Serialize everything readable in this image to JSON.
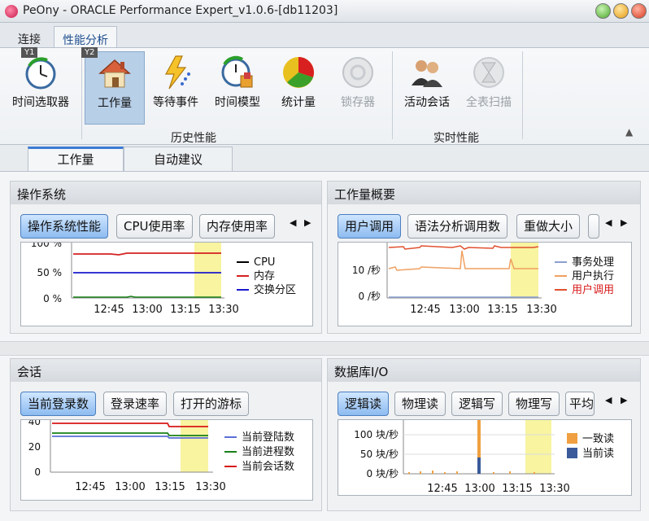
{
  "window": {
    "title": "PeOny - ORACLE Performance Expert_v1.0.6-[db11203]"
  },
  "menu_tabs": [
    {
      "label": "连接"
    },
    {
      "label": "性能分析"
    }
  ],
  "ribbon": {
    "badges": {
      "y1": "Y1",
      "y2": "Y2"
    },
    "buttons": [
      {
        "label": "时间选取器",
        "icon": "clock-icon"
      },
      {
        "label": "工作量",
        "icon": "house-icon"
      },
      {
        "label": "等待事件",
        "icon": "lightning-icon"
      },
      {
        "label": "时间模型",
        "icon": "model-clock-icon"
      },
      {
        "label": "统计量",
        "icon": "pie-chart-icon"
      },
      {
        "label": "锁存器",
        "icon": "latch-icon"
      },
      {
        "label": "活动会话",
        "icon": "users-icon"
      },
      {
        "label": "全表扫描",
        "icon": "hourglass-icon"
      }
    ],
    "groups": {
      "history": "历史性能",
      "realtime": "实时性能"
    }
  },
  "doc_tabs": [
    {
      "label": "工作量"
    },
    {
      "label": "自动建议"
    }
  ],
  "panels": {
    "os": {
      "title": "操作系统",
      "tabs": [
        "操作系统性能",
        "CPU使用率",
        "内存使用率"
      ],
      "y_ticks": [
        "100 %",
        "50 %",
        "0 %"
      ],
      "x_ticks": [
        "12:45",
        "13:00",
        "13:15",
        "13:30"
      ],
      "legend": [
        "CPU",
        "内存",
        "交换分区"
      ]
    },
    "workload": {
      "title": "工作量概要",
      "tabs": [
        "用户调用",
        "语法分析调用数",
        "重做大小"
      ],
      "y_ticks": [
        "10 /秒",
        "0 /秒"
      ],
      "x_ticks": [
        "12:45",
        "13:00",
        "13:15",
        "13:30"
      ],
      "legend": [
        "事务处理",
        "用户执行",
        "用户调用"
      ]
    },
    "session": {
      "title": "会话",
      "tabs": [
        "当前登录数",
        "登录速率",
        "打开的游标"
      ],
      "y_ticks": [
        "40",
        "20",
        "0"
      ],
      "x_ticks": [
        "12:45",
        "13:00",
        "13:15",
        "13:30"
      ],
      "legend": [
        "当前登陆数",
        "当前进程数",
        "当前会话数"
      ]
    },
    "dbio": {
      "title": "数据库I/O",
      "tabs": [
        "逻辑读",
        "物理读",
        "逻辑写",
        "物理写",
        "平均"
      ],
      "y_ticks": [
        "100 块/秒",
        "50 块/秒",
        "0 块/秒"
      ],
      "x_ticks": [
        "12:45",
        "13:00",
        "13:15",
        "13:30"
      ],
      "legend": [
        "一致读",
        "当前读"
      ]
    }
  },
  "colors": {
    "cpu": "#000000",
    "memory": "#d42020",
    "swap": "#1a1acc",
    "transactions": "#8aa0d0",
    "user_exec": "#f0a060",
    "user_calls": "#e05030",
    "logins": "#5a6fd8",
    "processes": "#188018",
    "sessions": "#d81818",
    "consistent_read": "#f0a040",
    "current_read": "#3a5a9a",
    "highlight": "#f8f4a0"
  }
}
